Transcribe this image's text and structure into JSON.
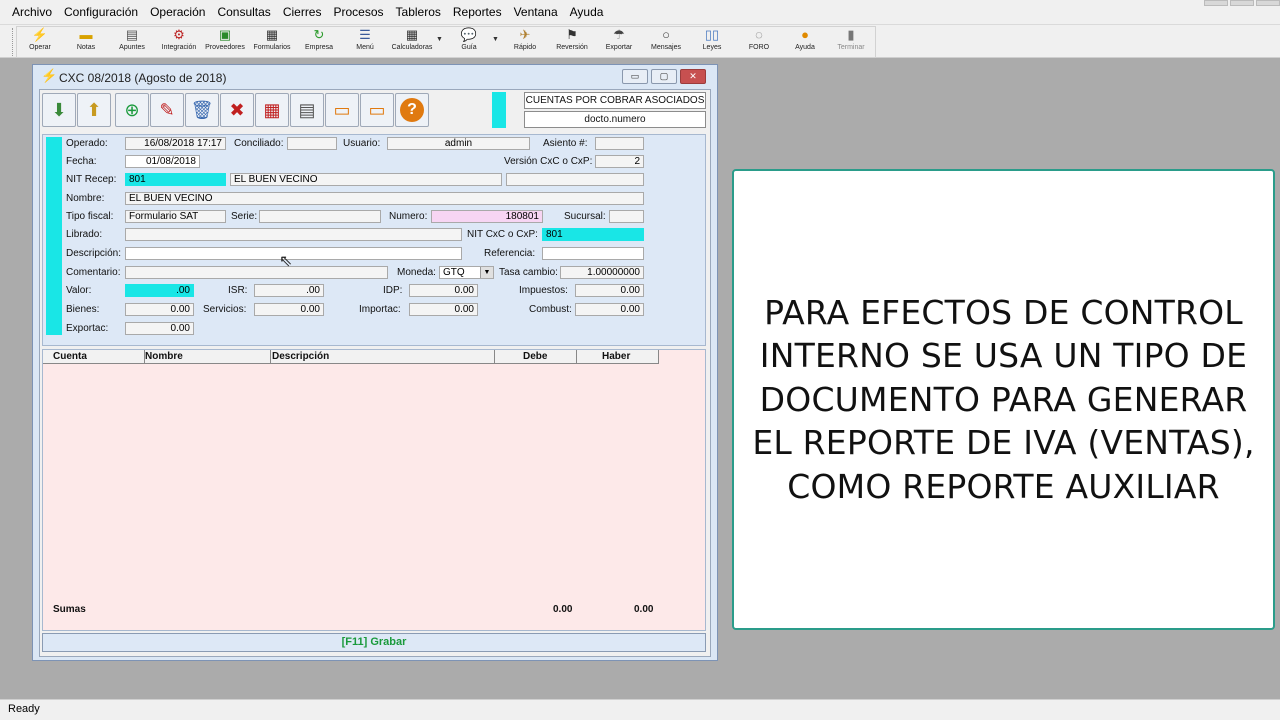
{
  "menu": [
    "Archivo",
    "Configuración",
    "Operación",
    "Consultas",
    "Cierres",
    "Procesos",
    "Tableros",
    "Reportes",
    "Ventana",
    "Ayuda"
  ],
  "toolbar": [
    {
      "label": "Operar",
      "icon": "lightning-icon"
    },
    {
      "label": "Notas",
      "icon": "note-icon"
    },
    {
      "label": "Apuntes",
      "icon": "ledger-icon"
    },
    {
      "label": "Integración",
      "icon": "integration-icon"
    },
    {
      "label": "Proveedores",
      "icon": "suppliers-icon"
    },
    {
      "label": "Formularios",
      "icon": "forms-icon"
    },
    {
      "label": "Empresa",
      "icon": "company-icon"
    },
    {
      "label": "Menú",
      "icon": "menu-icon"
    },
    {
      "label": "Calculadoras",
      "icon": "calculator-icon"
    },
    {
      "label": "Guía",
      "icon": "guide-icon"
    },
    {
      "label": "Rápido",
      "icon": "quick-icon"
    },
    {
      "label": "Reversión",
      "icon": "reversal-icon"
    },
    {
      "label": "Exportar",
      "icon": "export-icon"
    },
    {
      "label": "Mensajes",
      "icon": "messages-icon"
    },
    {
      "label": "Leyes",
      "icon": "laws-icon"
    },
    {
      "label": "FORO",
      "icon": "forum-icon"
    },
    {
      "label": "Ayuda",
      "icon": "help-icon"
    },
    {
      "label": "Terminar",
      "icon": "exit-icon"
    }
  ],
  "window": {
    "title": "CXC 08/2018 (Agosto de 2018)",
    "info_title": "CUENTAS POR COBRAR ASOCIADOS",
    "info_sub": "docto.numero"
  },
  "form": {
    "operado_label": "Operado:",
    "operado": "16/08/2018 17:17",
    "conciliado_label": "Conciliado:",
    "conciliado": "",
    "usuario_label": "Usuario:",
    "usuario": "admin",
    "asiento_label": "Asiento #:",
    "asiento": "",
    "fecha_label": "Fecha:",
    "fecha": "01/08/2018",
    "version_label": "Versión CxC o CxP:",
    "version": "2",
    "nit_label": "NIT Recep:",
    "nit": "801",
    "nit_nombre": "EL BUEN VECINO",
    "nombre_label": "Nombre:",
    "nombre": "EL BUEN VECINO",
    "tipo_label": "Tipo fiscal:",
    "tipo": "Formulario SAT",
    "serie_label": "Serie:",
    "serie": "",
    "numero_label": "Numero:",
    "numero": "180801",
    "sucursal_label": "Sucursal:",
    "sucursal": "",
    "librado_label": "Librado:",
    "librado": "",
    "nitcxc_label": "NIT CxC o CxP:",
    "nitcxc": "801",
    "descripcion_label": "Descripción:",
    "descripcion": "",
    "referencia_label": "Referencia:",
    "referencia": "",
    "comentario_label": "Comentario:",
    "comentario": "",
    "moneda_label": "Moneda:",
    "moneda": "GTQ",
    "tasa_label": "Tasa cambio:",
    "tasa": "1.00000000",
    "valor_label": "Valor:",
    "valor": ".00",
    "isr_label": "ISR:",
    "isr": ".00",
    "idp_label": "IDP:",
    "idp": "0.00",
    "impuestos_label": "Impuestos:",
    "impuestos": "0.00",
    "bienes_label": "Bienes:",
    "bienes": "0.00",
    "servicios_label": "Servicios:",
    "servicios": "0.00",
    "importac_label": "Importac:",
    "importac": "0.00",
    "combust_label": "Combust:",
    "combust": "0.00",
    "exportac_label": "Exportac:",
    "exportac": "0.00"
  },
  "grid": {
    "headers": [
      "Cuenta",
      "Nombre",
      "Descripción",
      "Debe",
      "Haber"
    ],
    "sumas_label": "Sumas",
    "sum_debe": "0.00",
    "sum_haber": "0.00"
  },
  "save_label": "[F11] Grabar",
  "status": "Ready",
  "overlay_text": "PARA EFECTOS DE CONTROL INTERNO SE USA UN TIPO DE DOCUMENTO PARA GENERAR EL REPORTE DE IVA (VENTAS), COMO REPORTE AUXILIAR",
  "colors": {
    "accent_cyan": "#19e6e6",
    "save_green": "#1a9a3c",
    "card_border": "#2a9c8a"
  }
}
